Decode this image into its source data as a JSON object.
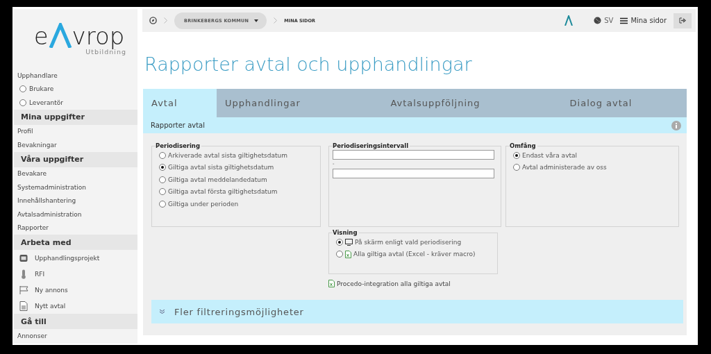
{
  "logo": {
    "left": "e",
    "right": "vrop",
    "sub": "Utbildning"
  },
  "sidebar": {
    "items": [
      {
        "kind": "label",
        "label": "Upphandlare"
      },
      {
        "kind": "radio",
        "label": "Brukare",
        "selected": false
      },
      {
        "kind": "radio",
        "label": "Leverantör",
        "selected": false
      },
      {
        "kind": "header",
        "label": "Mina uppgifter"
      },
      {
        "kind": "link",
        "label": "Profil"
      },
      {
        "kind": "link",
        "label": "Bevakningar"
      },
      {
        "kind": "header",
        "label": "Våra uppgifter"
      },
      {
        "kind": "link",
        "label": "Bevakare"
      },
      {
        "kind": "link",
        "label": "Systemadministration"
      },
      {
        "kind": "link",
        "label": "Innehållshantering"
      },
      {
        "kind": "link",
        "label": "Avtalsadministration"
      },
      {
        "kind": "link",
        "label": "Rapporter"
      },
      {
        "kind": "header",
        "label": "Arbeta med"
      },
      {
        "kind": "iconlink",
        "label": "Upphandlingsprojekt"
      },
      {
        "kind": "iconlink",
        "label": "RFI"
      },
      {
        "kind": "iconlink",
        "label": "Ny annons"
      },
      {
        "kind": "iconlink",
        "label": "Nytt avtal"
      },
      {
        "kind": "header",
        "label": "Gå till"
      },
      {
        "kind": "link",
        "label": "Annonser"
      }
    ]
  },
  "topbar": {
    "organization": "BRINKEBERGS KOMMUN",
    "page": "MINA SIDOR",
    "language": "SV",
    "menu": "Mina sidor"
  },
  "title": "Rapporter avtal och upphandlingar",
  "tabs": [
    {
      "label": "Avtal",
      "selected": true
    },
    {
      "label": "Upphandlingar",
      "selected": false
    },
    {
      "label": "Avtalsuppföljning",
      "selected": false
    },
    {
      "label": "Dialog avtal",
      "selected": false
    }
  ],
  "subheader": "Rapporter avtal",
  "periodisering": {
    "legend": "Periodisering",
    "options": [
      {
        "label": "Arkiverade avtal sista giltighetsdatum",
        "selected": false
      },
      {
        "label": "Giltiga avtal sista giltighetsdatum",
        "selected": true
      },
      {
        "label": "Giltiga avtal meddelandedatum",
        "selected": false
      },
      {
        "label": "Giltiga avtal första giltighetsdatum",
        "selected": false
      },
      {
        "label": "Giltiga under perioden",
        "selected": false
      }
    ]
  },
  "intervall": {
    "legend": "Periodiseringsintervall",
    "separator": "-"
  },
  "omfang": {
    "legend": "Omfång",
    "options": [
      {
        "label": "Endast våra avtal",
        "selected": true
      },
      {
        "label": "Avtal administerade av oss",
        "selected": false
      }
    ]
  },
  "visning": {
    "legend": "Visning",
    "options": [
      {
        "label": "På skärm enligt vald periodisering",
        "selected": true
      },
      {
        "label": "Alla giltiga avtal (Excel - kräver macro)",
        "selected": false
      }
    ]
  },
  "procedo_link": "Procedo-integration alla giltiga avtal",
  "more_filters": {
    "label": "Fler filtreringsmöjligheter",
    "expanded": false
  }
}
